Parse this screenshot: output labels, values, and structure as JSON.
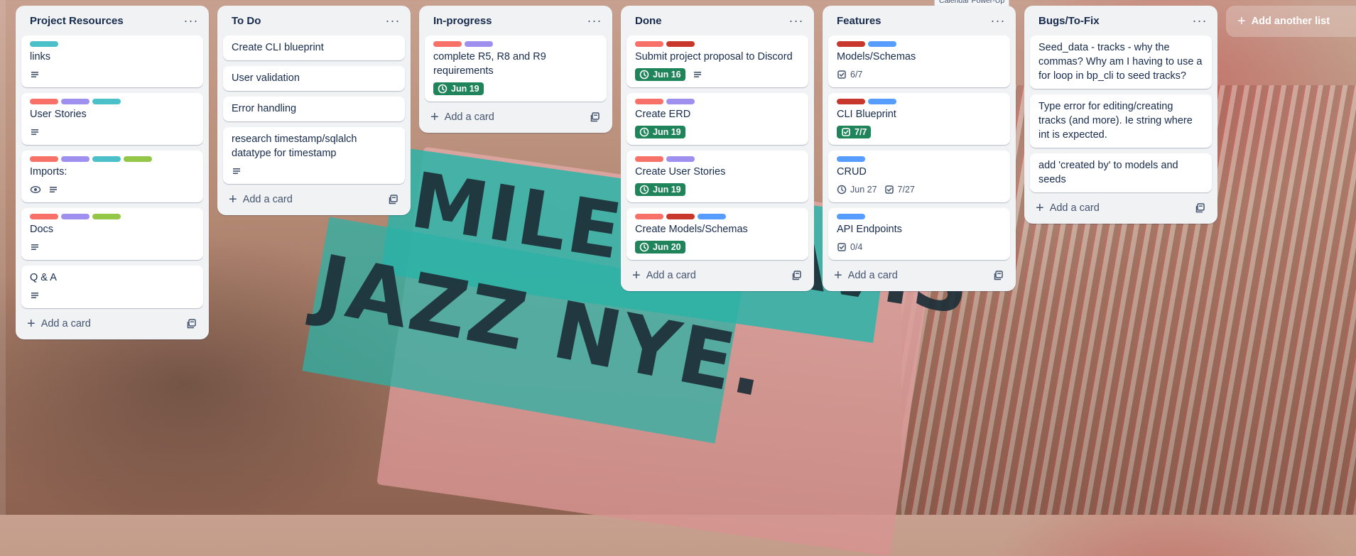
{
  "tooltip": "Calendar Power-Up",
  "lists": [
    {
      "title": "Project Resources",
      "add_card": "Add a card",
      "cards": [
        {
          "labels": [
            "#4bc0c8"
          ],
          "title": "links",
          "badges": [
            {
              "type": "description"
            }
          ]
        },
        {
          "labels": [
            "#f87168",
            "#9f8fef",
            "#4bc0c8"
          ],
          "title": "User Stories",
          "badges": [
            {
              "type": "description"
            }
          ]
        },
        {
          "labels": [
            "#f87168",
            "#9f8fef",
            "#4bc0c8",
            "#94c748"
          ],
          "title": "Imports:",
          "badges": [
            {
              "type": "watch"
            },
            {
              "type": "description"
            }
          ]
        },
        {
          "labels": [
            "#f87168",
            "#9f8fef",
            "#94c748"
          ],
          "title": "Docs",
          "badges": [
            {
              "type": "description"
            }
          ]
        },
        {
          "labels": [],
          "title": "Q & A",
          "badges": [
            {
              "type": "description"
            }
          ]
        }
      ]
    },
    {
      "title": "To Do",
      "add_card": "Add a card",
      "cards": [
        {
          "labels": [],
          "title": "Create CLI blueprint",
          "badges": []
        },
        {
          "labels": [],
          "title": "User validation",
          "badges": []
        },
        {
          "labels": [],
          "title": "Error handling",
          "badges": []
        },
        {
          "labels": [],
          "title": "research timestamp/sqlalch datatype for timestamp",
          "badges": [
            {
              "type": "description"
            }
          ]
        }
      ]
    },
    {
      "title": "In-progress",
      "add_card": "Add a card",
      "cards": [
        {
          "labels": [
            "#f87168",
            "#9f8fef"
          ],
          "title": "complete R5, R8 and R9 requirements",
          "badges": [
            {
              "type": "due",
              "text": "Jun 19"
            }
          ]
        }
      ]
    },
    {
      "title": "Done",
      "add_card": "Add a card",
      "cards": [
        {
          "labels": [
            "#f87168",
            "#c9372c"
          ],
          "title": "Submit project proposal to Discord",
          "badges": [
            {
              "type": "due",
              "text": "Jun 16"
            },
            {
              "type": "description"
            }
          ]
        },
        {
          "labels": [
            "#f87168",
            "#9f8fef"
          ],
          "title": "Create ERD",
          "badges": [
            {
              "type": "due",
              "text": "Jun 19"
            }
          ]
        },
        {
          "labels": [
            "#f87168",
            "#9f8fef"
          ],
          "title": "Create User Stories",
          "badges": [
            {
              "type": "due",
              "text": "Jun 19"
            }
          ]
        },
        {
          "labels": [
            "#f87168",
            "#c9372c",
            "#579dff"
          ],
          "title": "Create Models/Schemas",
          "badges": [
            {
              "type": "due",
              "text": "Jun 20"
            }
          ]
        }
      ]
    },
    {
      "title": "Features",
      "add_card": "Add a card",
      "cards": [
        {
          "labels": [
            "#c9372c",
            "#579dff"
          ],
          "title": "Models/Schemas",
          "badges": [
            {
              "type": "checklist",
              "text": "6/7"
            }
          ]
        },
        {
          "labels": [
            "#c9372c",
            "#579dff"
          ],
          "title": "CLI Blueprint",
          "badges": [
            {
              "type": "checklist-complete",
              "text": "7/7"
            }
          ]
        },
        {
          "labels": [
            "#579dff"
          ],
          "title": "CRUD",
          "badges": [
            {
              "type": "date",
              "text": "Jun 27"
            },
            {
              "type": "checklist",
              "text": "7/27"
            }
          ]
        },
        {
          "labels": [
            "#579dff"
          ],
          "title": "API Endpoints",
          "badges": [
            {
              "type": "checklist",
              "text": "0/4"
            }
          ]
        }
      ]
    },
    {
      "title": "Bugs/To-Fix",
      "add_card": "Add a card",
      "cards": [
        {
          "labels": [],
          "title": "Seed_data - tracks - why the commas? Why am I having to use a for loop in bp_cli to seed tracks?",
          "badges": []
        },
        {
          "labels": [],
          "title": "Type error for editing/creating tracks (and more). Ie string where int is expected.",
          "badges": []
        },
        {
          "labels": [],
          "title": "add 'created by' to models and seeds",
          "badges": []
        }
      ]
    }
  ],
  "add_another_list": "Add another list",
  "background_text": [
    "MILES DAVIS",
    "JAZZ NYE."
  ]
}
